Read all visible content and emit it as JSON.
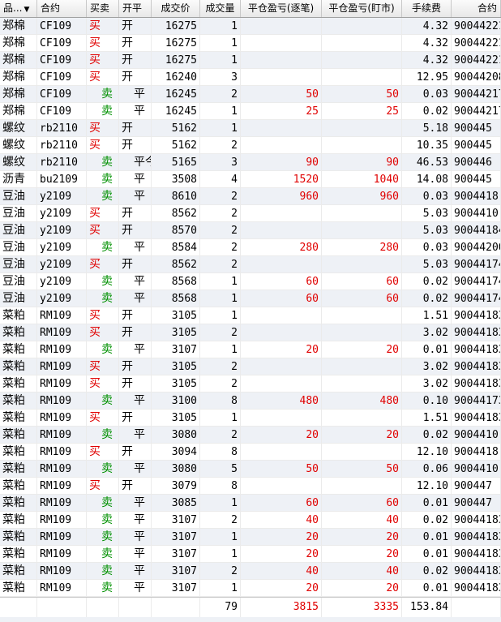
{
  "headers": [
    "品...",
    "合约",
    "买卖",
    "开平",
    "成交价",
    "成交量",
    "平仓盈亏(逐笔)",
    "平仓盈亏(盯市)",
    "手续费",
    "合约"
  ],
  "sort_icon": "▼",
  "rows": [
    {
      "name": "郑棉",
      "contract": "CF109",
      "side": "买",
      "oc": "开",
      "price": "16275",
      "qty": "1",
      "pnl1": "",
      "pnl2": "",
      "fee": "4.32",
      "order": "90044221"
    },
    {
      "name": "郑棉",
      "contract": "CF109",
      "side": "买",
      "oc": "开",
      "price": "16275",
      "qty": "1",
      "pnl1": "",
      "pnl2": "",
      "fee": "4.32",
      "order": "90044221"
    },
    {
      "name": "郑棉",
      "contract": "CF109",
      "side": "买",
      "oc": "开",
      "price": "16275",
      "qty": "1",
      "pnl1": "",
      "pnl2": "",
      "fee": "4.32",
      "order": "90044221"
    },
    {
      "name": "郑棉",
      "contract": "CF109",
      "side": "买",
      "oc": "开",
      "price": "16240",
      "qty": "3",
      "pnl1": "",
      "pnl2": "",
      "fee": "12.95",
      "order": "90044208"
    },
    {
      "name": "郑棉",
      "contract": "CF109",
      "side": "卖",
      "oc": "平",
      "price": "16245",
      "qty": "2",
      "pnl1": "50",
      "pnl2": "50",
      "fee": "0.03",
      "order": "90044217"
    },
    {
      "name": "郑棉",
      "contract": "CF109",
      "side": "卖",
      "oc": "平",
      "price": "16245",
      "qty": "1",
      "pnl1": "25",
      "pnl2": "25",
      "fee": "0.02",
      "order": "90044217"
    },
    {
      "name": "螺纹",
      "contract": "rb2110",
      "side": "买",
      "oc": "开",
      "price": "5162",
      "qty": "1",
      "pnl1": "",
      "pnl2": "",
      "fee": "5.18",
      "order": "900445"
    },
    {
      "name": "螺纹",
      "contract": "rb2110",
      "side": "买",
      "oc": "开",
      "price": "5162",
      "qty": "2",
      "pnl1": "",
      "pnl2": "",
      "fee": "10.35",
      "order": "900445"
    },
    {
      "name": "螺纹",
      "contract": "rb2110",
      "side": "卖",
      "oc": "平今",
      "price": "5165",
      "qty": "3",
      "pnl1": "90",
      "pnl2": "90",
      "fee": "46.53",
      "order": "900446"
    },
    {
      "name": "沥青",
      "contract": "bu2109",
      "side": "卖",
      "oc": "平",
      "price": "3508",
      "qty": "4",
      "pnl1": "1520",
      "pnl2": "1040",
      "fee": "14.08",
      "order": "900445"
    },
    {
      "name": "豆油",
      "contract": "y2109",
      "side": "卖",
      "oc": "平",
      "price": "8610",
      "qty": "2",
      "pnl1": "960",
      "pnl2": "960",
      "fee": "0.03",
      "order": "9004418"
    },
    {
      "name": "豆油",
      "contract": "y2109",
      "side": "买",
      "oc": "开",
      "price": "8562",
      "qty": "2",
      "pnl1": "",
      "pnl2": "",
      "fee": "5.03",
      "order": "9004410"
    },
    {
      "name": "豆油",
      "contract": "y2109",
      "side": "买",
      "oc": "开",
      "price": "8570",
      "qty": "2",
      "pnl1": "",
      "pnl2": "",
      "fee": "5.03",
      "order": "90044184"
    },
    {
      "name": "豆油",
      "contract": "y2109",
      "side": "卖",
      "oc": "平",
      "price": "8584",
      "qty": "2",
      "pnl1": "280",
      "pnl2": "280",
      "fee": "0.03",
      "order": "90044200"
    },
    {
      "name": "豆油",
      "contract": "y2109",
      "side": "买",
      "oc": "开",
      "price": "8562",
      "qty": "2",
      "pnl1": "",
      "pnl2": "",
      "fee": "5.03",
      "order": "90044174"
    },
    {
      "name": "豆油",
      "contract": "y2109",
      "side": "卖",
      "oc": "平",
      "price": "8568",
      "qty": "1",
      "pnl1": "60",
      "pnl2": "60",
      "fee": "0.02",
      "order": "90044174"
    },
    {
      "name": "豆油",
      "contract": "y2109",
      "side": "卖",
      "oc": "平",
      "price": "8568",
      "qty": "1",
      "pnl1": "60",
      "pnl2": "60",
      "fee": "0.02",
      "order": "90044174"
    },
    {
      "name": "菜粕",
      "contract": "RM109",
      "side": "买",
      "oc": "开",
      "price": "3105",
      "qty": "1",
      "pnl1": "",
      "pnl2": "",
      "fee": "1.51",
      "order": "90044183"
    },
    {
      "name": "菜粕",
      "contract": "RM109",
      "side": "买",
      "oc": "开",
      "price": "3105",
      "qty": "2",
      "pnl1": "",
      "pnl2": "",
      "fee": "3.02",
      "order": "90044183"
    },
    {
      "name": "菜粕",
      "contract": "RM109",
      "side": "卖",
      "oc": "平",
      "price": "3107",
      "qty": "1",
      "pnl1": "20",
      "pnl2": "20",
      "fee": "0.01",
      "order": "90044183"
    },
    {
      "name": "菜粕",
      "contract": "RM109",
      "side": "买",
      "oc": "开",
      "price": "3105",
      "qty": "2",
      "pnl1": "",
      "pnl2": "",
      "fee": "3.02",
      "order": "90044183"
    },
    {
      "name": "菜粕",
      "contract": "RM109",
      "side": "买",
      "oc": "开",
      "price": "3105",
      "qty": "2",
      "pnl1": "",
      "pnl2": "",
      "fee": "3.02",
      "order": "90044183"
    },
    {
      "name": "菜粕",
      "contract": "RM109",
      "side": "卖",
      "oc": "平",
      "price": "3100",
      "qty": "8",
      "pnl1": "480",
      "pnl2": "480",
      "fee": "0.10",
      "order": "90044173"
    },
    {
      "name": "菜粕",
      "contract": "RM109",
      "side": "买",
      "oc": "开",
      "price": "3105",
      "qty": "1",
      "pnl1": "",
      "pnl2": "",
      "fee": "1.51",
      "order": "90044183"
    },
    {
      "name": "菜粕",
      "contract": "RM109",
      "side": "卖",
      "oc": "平",
      "price": "3080",
      "qty": "2",
      "pnl1": "20",
      "pnl2": "20",
      "fee": "0.02",
      "order": "9004410"
    },
    {
      "name": "菜粕",
      "contract": "RM109",
      "side": "买",
      "oc": "开",
      "price": "3094",
      "qty": "8",
      "pnl1": "",
      "pnl2": "",
      "fee": "12.10",
      "order": "9004418"
    },
    {
      "name": "菜粕",
      "contract": "RM109",
      "side": "卖",
      "oc": "平",
      "price": "3080",
      "qty": "5",
      "pnl1": "50",
      "pnl2": "50",
      "fee": "0.06",
      "order": "9004410"
    },
    {
      "name": "菜粕",
      "contract": "RM109",
      "side": "买",
      "oc": "开",
      "price": "3079",
      "qty": "8",
      "pnl1": "",
      "pnl2": "",
      "fee": "12.10",
      "order": "900447"
    },
    {
      "name": "菜粕",
      "contract": "RM109",
      "side": "卖",
      "oc": "平",
      "price": "3085",
      "qty": "1",
      "pnl1": "60",
      "pnl2": "60",
      "fee": "0.01",
      "order": "900447"
    },
    {
      "name": "菜粕",
      "contract": "RM109",
      "side": "卖",
      "oc": "平",
      "price": "3107",
      "qty": "2",
      "pnl1": "40",
      "pnl2": "40",
      "fee": "0.02",
      "order": "90044183"
    },
    {
      "name": "菜粕",
      "contract": "RM109",
      "side": "卖",
      "oc": "平",
      "price": "3107",
      "qty": "1",
      "pnl1": "20",
      "pnl2": "20",
      "fee": "0.01",
      "order": "90044183"
    },
    {
      "name": "菜粕",
      "contract": "RM109",
      "side": "卖",
      "oc": "平",
      "price": "3107",
      "qty": "1",
      "pnl1": "20",
      "pnl2": "20",
      "fee": "0.01",
      "order": "90044183"
    },
    {
      "name": "菜粕",
      "contract": "RM109",
      "side": "卖",
      "oc": "平",
      "price": "3107",
      "qty": "2",
      "pnl1": "40",
      "pnl2": "40",
      "fee": "0.02",
      "order": "90044183"
    },
    {
      "name": "菜粕",
      "contract": "RM109",
      "side": "卖",
      "oc": "平",
      "price": "3107",
      "qty": "1",
      "pnl1": "20",
      "pnl2": "20",
      "fee": "0.01",
      "order": "90044183"
    }
  ],
  "totals": {
    "qty": "79",
    "pnl1": "3815",
    "pnl2": "3335",
    "fee": "153.84"
  },
  "colors": {
    "buy": "#e00000",
    "sell": "#009000",
    "pnl": "#e00000"
  }
}
